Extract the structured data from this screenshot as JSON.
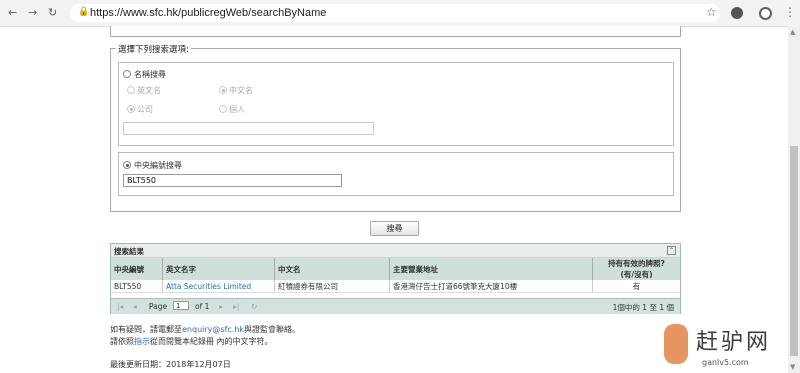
{
  "browser": {
    "url": "https://www.sfc.hk/publicregWeb/searchByName"
  },
  "form": {
    "legend": "選擇下列搜索選項:",
    "name_search": {
      "label": "名稱搜尋",
      "english_label": "英文名",
      "chinese_label": "中文名",
      "company_label": "公司",
      "individual_label": "個人",
      "name_value": ""
    },
    "ce_search": {
      "label": "中央編號搜尋",
      "value": "BLT550"
    },
    "search_button": "搜尋"
  },
  "results": {
    "title": "搜索結果",
    "columns": [
      "中央編號",
      "英文名字",
      "中文名",
      "主要營業地址",
      "持有有效的牌照?",
      "(有/沒有)"
    ],
    "rows": [
      {
        "ce_no": "BLT550",
        "english_name": "Atta Securities Limited",
        "chinese_name": "紅犢證券有限公司",
        "address": "香港灣仔告士打道66號筆克大廈10樓",
        "licensed": "有"
      }
    ],
    "pager": {
      "page_label": "Page",
      "page_value": "1",
      "of_label": "of 1",
      "summary": "1個中的 1 至 1 個"
    }
  },
  "footer": {
    "line1_prefix": "如有疑問，請電郵至",
    "email": "enquiry@sfc.hk",
    "line1_suffix": "與證監會聯絡。",
    "line2_prefix": "請依照",
    "line2_link": "指示",
    "line2_suffix": "從而閱覽本紀錄冊 內的中文字符。",
    "last_updated": "最後更新日期：2018年12月07日"
  },
  "watermark": {
    "chinese": "赶驴网",
    "url": "ganlv5.com"
  }
}
